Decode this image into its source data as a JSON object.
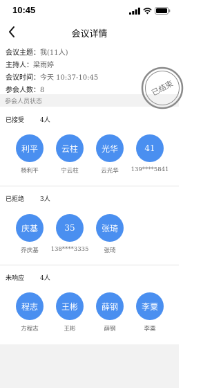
{
  "status_bar": {
    "time": "10:45"
  },
  "nav": {
    "title": "会议详情"
  },
  "meeting": {
    "topic_label": "会议主题：",
    "topic_value": "我(11人)",
    "host_label": "主持人：",
    "host_value": "梁雨婷",
    "time_label": "会议时间：",
    "time_value": "今天 10:37-10:45",
    "count_label": "参会人数：",
    "count_value": "8"
  },
  "stamp_text": "已结束",
  "participants_header": "参会人员状态",
  "groups": [
    {
      "title": "已接受",
      "count": "4人",
      "people": [
        {
          "avatar": "利平",
          "name": "杨利平"
        },
        {
          "avatar": "云柱",
          "name": "宁云柱"
        },
        {
          "avatar": "光华",
          "name": "云光华"
        },
        {
          "avatar": "41",
          "name": "139****5841"
        }
      ]
    },
    {
      "title": "已拒绝",
      "count": "3人",
      "people": [
        {
          "avatar": "庆基",
          "name": "乔庆基"
        },
        {
          "avatar": "35",
          "name": "138****3335"
        },
        {
          "avatar": "张琦",
          "name": "张琦"
        }
      ]
    },
    {
      "title": "未响应",
      "count": "4人",
      "people": [
        {
          "avatar": "程志",
          "name": "方程志"
        },
        {
          "avatar": "王彬",
          "name": "王彬"
        },
        {
          "avatar": "薛钢",
          "name": "薛钢"
        },
        {
          "avatar": "李粟",
          "name": "李粟"
        }
      ]
    }
  ],
  "colors": {
    "avatar": "#4a8ff0",
    "stamp": "#8a8a8a"
  }
}
